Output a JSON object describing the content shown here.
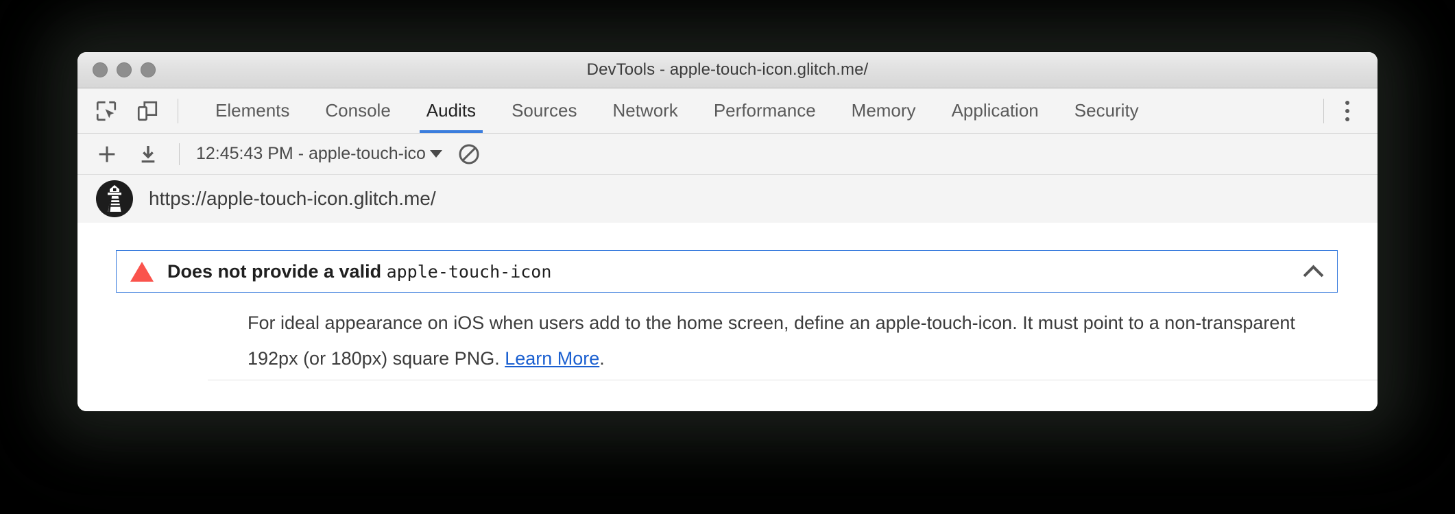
{
  "window": {
    "title": "DevTools - apple-touch-icon.glitch.me/",
    "traffic_lights": [
      "close",
      "minimize",
      "zoom"
    ]
  },
  "devtools_toolbar": {
    "inspect_icon": "inspect-element-icon",
    "device_icon": "device-toolbar-icon",
    "more_icon": "vertical-dots-icon"
  },
  "tabs": [
    {
      "label": "Elements",
      "selected": false
    },
    {
      "label": "Console",
      "selected": false
    },
    {
      "label": "Audits",
      "selected": true
    },
    {
      "label": "Sources",
      "selected": false
    },
    {
      "label": "Network",
      "selected": false
    },
    {
      "label": "Performance",
      "selected": false
    },
    {
      "label": "Memory",
      "selected": false
    },
    {
      "label": "Application",
      "selected": false
    },
    {
      "label": "Security",
      "selected": false
    }
  ],
  "audit_toolbar": {
    "add_icon": "plus-icon",
    "download_icon": "download-icon",
    "report_selected": "12:45:43 PM - apple-touch-ico",
    "clear_icon": "no-entry-clear-icon"
  },
  "url_row": {
    "logo": "lighthouse-logo",
    "url": "https://apple-touch-icon.glitch.me/"
  },
  "report": {
    "audit": {
      "status_icon": "warning-triangle-icon",
      "title_prefix": "Does not provide a valid ",
      "title_code": "apple-touch-icon",
      "expanded": true,
      "collapse_icon": "chevron-up-icon",
      "description_part1": "For ideal appearance on iOS when users add to the home screen, define an apple-touch-icon. It must point to a non-transparent 192px (or 180px) square PNG. ",
      "link_label": "Learn More",
      "description_part2": "."
    }
  },
  "colors": {
    "accent_blue": "#3b7ddd",
    "link_blue": "#1a5fd0",
    "warning_red": "#fa534c",
    "chrome_gray": "#f4f4f4",
    "titlebar_gray": "#e0e0e0",
    "page_background": "#000000"
  }
}
